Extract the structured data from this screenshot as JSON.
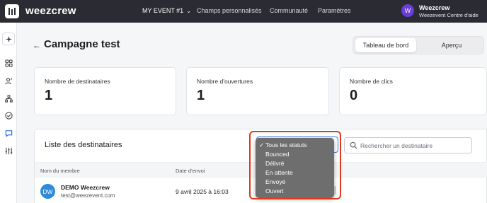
{
  "topbar": {
    "brand": "weezcrew",
    "event_label": "MY EVENT #1",
    "nav": [
      "Champs personnalisés",
      "Communauté",
      "Paramètres"
    ],
    "user": {
      "initial": "W",
      "name": "Weezcrew",
      "org": "Weezevent Centre d'aide"
    }
  },
  "sidebar": {
    "icons": [
      "sparkle-icon",
      "apps-icon",
      "users-icon",
      "org-chart-icon",
      "check-circle-icon",
      "message-icon",
      "sliders-icon"
    ]
  },
  "header": {
    "title": "Campagne test",
    "tabs": [
      "Tableau de bord",
      "Aperçu"
    ]
  },
  "stats": [
    {
      "label": "Nombre de destinataires",
      "value": "1"
    },
    {
      "label": "Nombre d'ouvertures",
      "value": "1"
    },
    {
      "label": "Nombre de clics",
      "value": "0"
    }
  ],
  "recipients": {
    "title": "Liste des destinataires",
    "search_placeholder": "Rechercher un destinataire",
    "columns": [
      "Nom du membre",
      "Date d'envoi"
    ],
    "rows": [
      {
        "initials": "DW",
        "name": "DEMO Weezcrew",
        "email": "test@weezevent.com",
        "date": "9 avril 2025 à 16:03"
      }
    ]
  },
  "status_filter": {
    "selected": "Tous les statuts",
    "options": [
      "Tous les statuts",
      "Bounced",
      "Délivré",
      "En attente",
      "Envoyé",
      "Ouvert"
    ]
  },
  "colors": {
    "topbar": "#2b2b33",
    "accent": "#6a3ddb",
    "highlight": "#e0391c",
    "menu": "#6e6e6e"
  }
}
